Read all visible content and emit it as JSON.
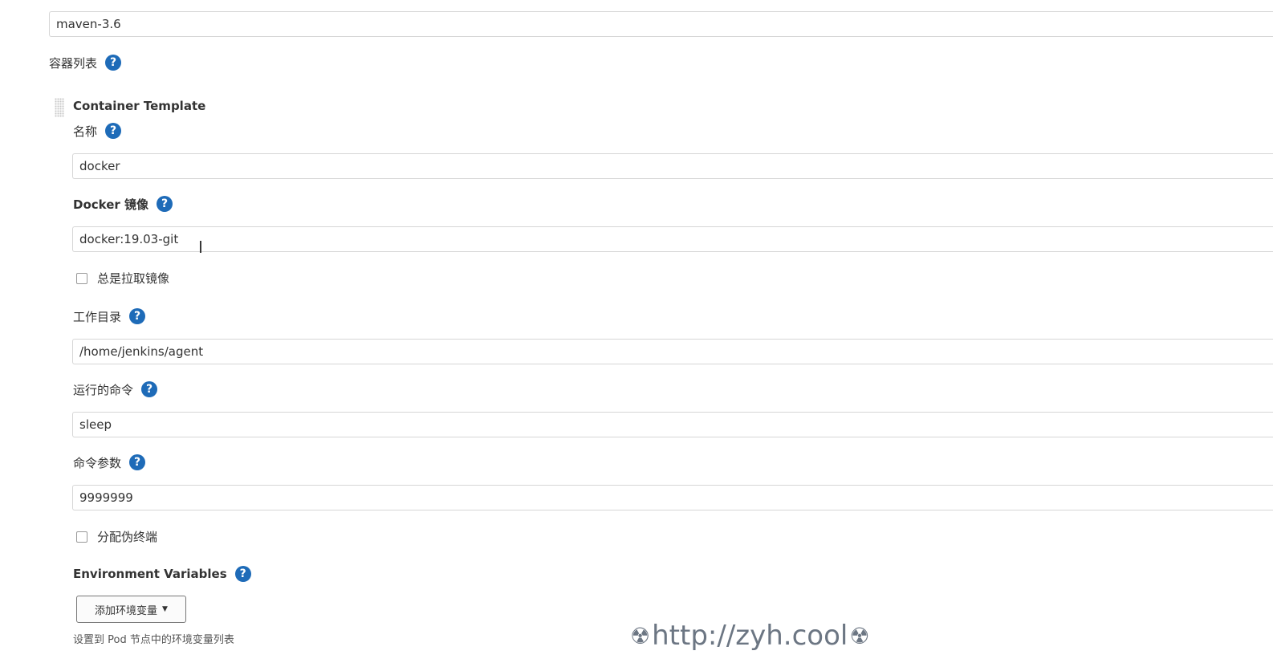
{
  "maven_field": {
    "value": "maven-3.6"
  },
  "container_list": {
    "label": "容器列表"
  },
  "container_template": {
    "title": "Container Template",
    "name": {
      "label": "名称",
      "value": "docker"
    },
    "docker_image": {
      "label": "Docker 镜像",
      "value": "docker:19.03-git"
    },
    "always_pull": {
      "label": "总是拉取镜像",
      "checked": false
    },
    "working_dir": {
      "label": "工作目录",
      "value": "/home/jenkins/agent"
    },
    "command": {
      "label": "运行的命令",
      "value": "sleep"
    },
    "args": {
      "label": "命令参数",
      "value": "9999999"
    },
    "allocate_tty": {
      "label": "分配伪终端",
      "checked": false
    },
    "env_vars": {
      "label": "Environment Variables",
      "add_button": "添加环境变量",
      "hint": "设置到 Pod 节点中的环境变量列表"
    }
  },
  "help_glyph": "?",
  "icons": {
    "help": "help-icon",
    "dropdown": "caret-down-icon",
    "grip": "drag-handle-icon",
    "hazard": "radiation-icon"
  },
  "watermark": "http://zyh.cool",
  "colors": {
    "help_icon": "#1e6bb8",
    "watermark": "#6c7683"
  }
}
